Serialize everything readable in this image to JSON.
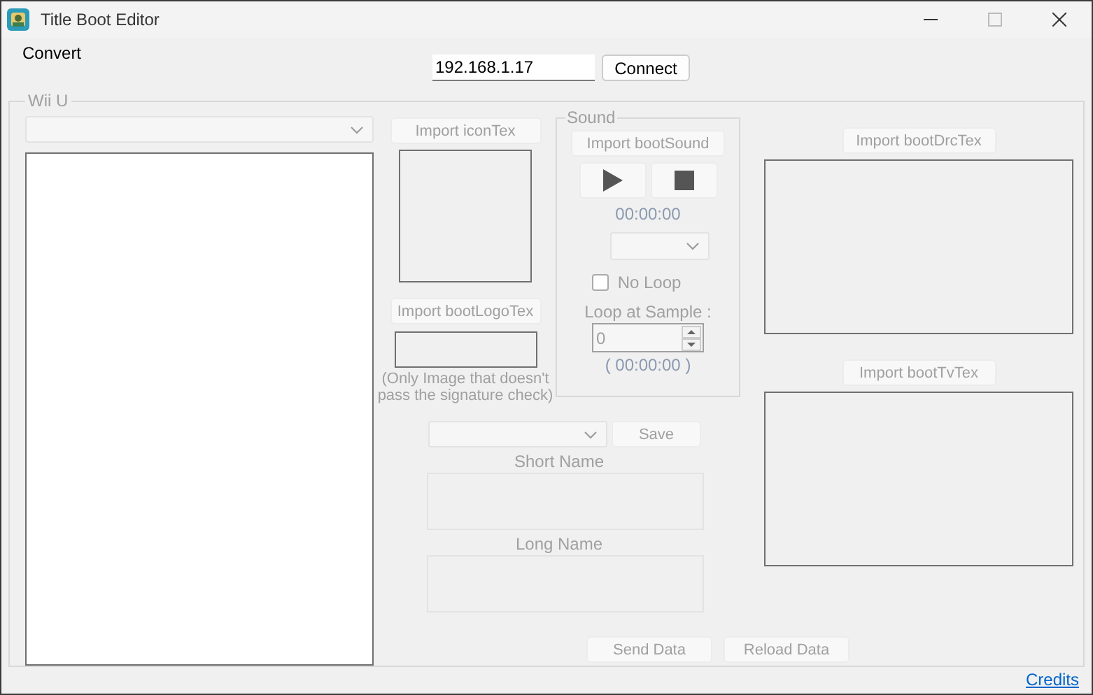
{
  "window": {
    "title": "Title Boot Editor"
  },
  "menu": [
    "Convert"
  ],
  "connection": {
    "ip": "192.168.1.17",
    "button": {
      "label": "Connect",
      "disabled": false
    }
  },
  "group": {
    "title": "Wii U",
    "left": {
      "combo_disabled": true
    },
    "icon_tex": {
      "label": "Import iconTex",
      "disabled": true
    },
    "boot_logo_tex": {
      "label": "Import bootLogoTex",
      "disabled": true
    },
    "note": "(Only Image that doesn't pass the signature check)",
    "sound": {
      "title": "Sound",
      "import": {
        "label": "Import bootSound",
        "disabled": true
      },
      "time": "00:00:00",
      "no_loop": {
        "label": "No Loop",
        "checked": false
      },
      "loop_label": "Loop at Sample :",
      "loop_value": "0",
      "loop_time": "( 00:00:00 )"
    },
    "save": {
      "label": "Save",
      "disabled": true
    },
    "short_name": "Short Name",
    "long_name": "Long Name",
    "drc_tex": {
      "label": "Import bootDrcTex",
      "disabled": true
    },
    "tv_tex": {
      "label": "Import bootTvTex",
      "disabled": true
    },
    "actions": [
      {
        "label": "Send Data",
        "disabled": true
      },
      {
        "label": "Reload Data",
        "disabled": true
      }
    ]
  },
  "footer": {
    "link": "Credits"
  }
}
